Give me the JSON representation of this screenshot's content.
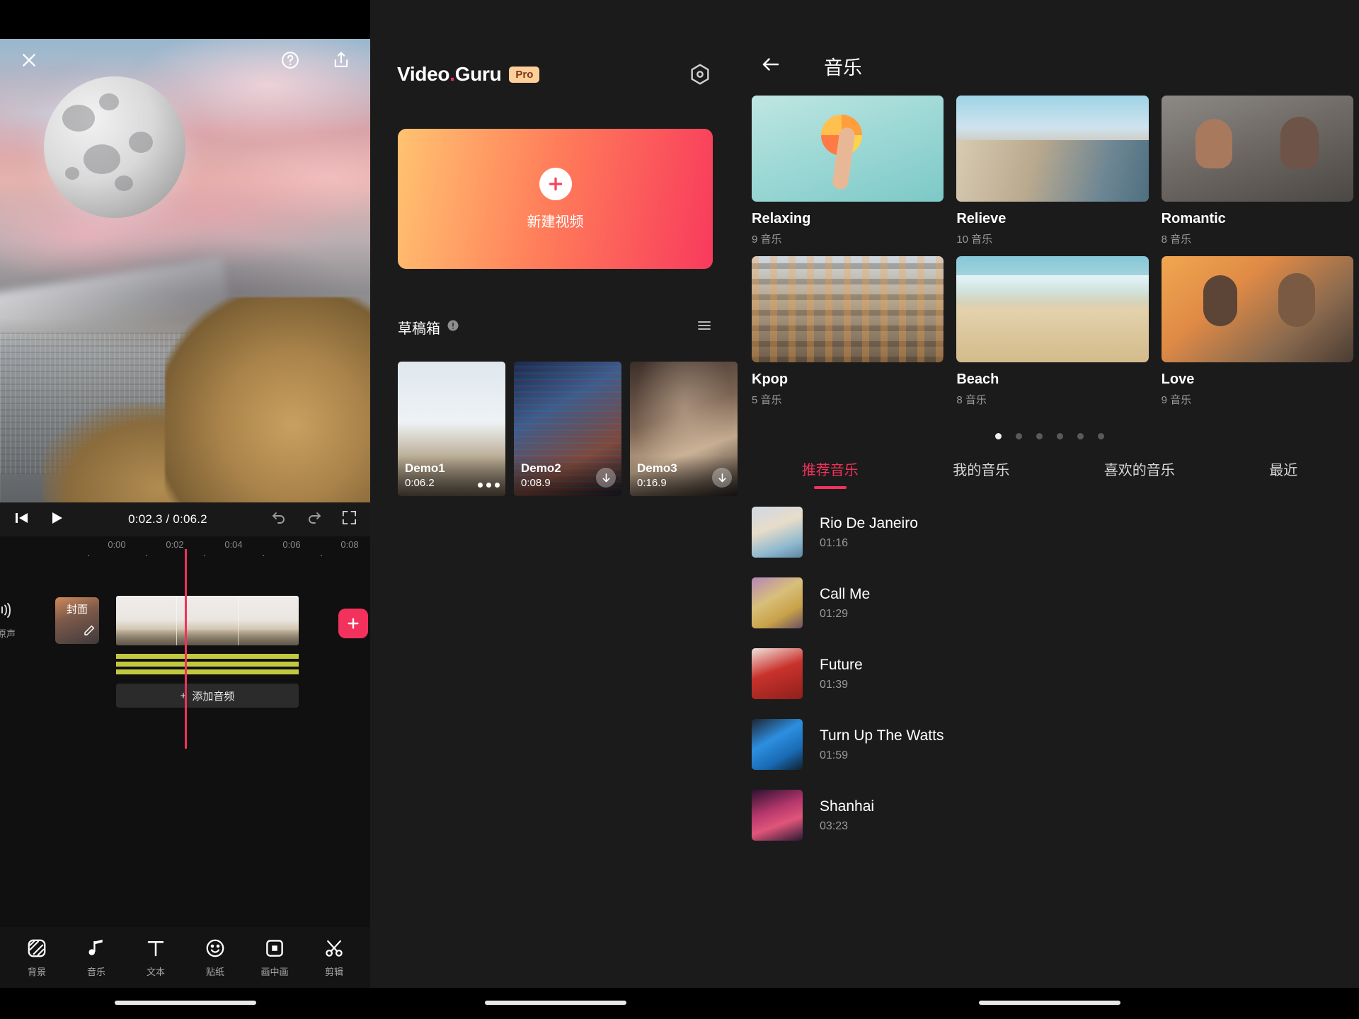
{
  "editor": {
    "close_icon": "close-icon",
    "help_icon": "help-icon",
    "share_icon": "share-icon",
    "prev_frame_icon": "previous-frame-icon",
    "play_icon": "play-icon",
    "undo_icon": "undo-icon",
    "redo_icon": "redo-icon",
    "fullscreen_icon": "fullscreen-icon",
    "current_time": "0:02.3",
    "total_time": "0:06.2",
    "time_display": "0:02.3 / 0:06.2",
    "ruler_ticks": [
      "0:00",
      "0:02",
      "0:04",
      "0:06",
      "0:08"
    ],
    "original_sound_label": "原声",
    "cover_label": "封面",
    "add_audio_label": "添加音频",
    "add_clip_label": "+",
    "tabs": [
      {
        "label": "背景",
        "icon": "background-icon"
      },
      {
        "label": "音乐",
        "icon": "music-note-icon"
      },
      {
        "label": "文本",
        "icon": "text-icon"
      },
      {
        "label": "贴纸",
        "icon": "sticker-smiley-icon"
      },
      {
        "label": "画中画",
        "icon": "picture-in-picture-icon"
      },
      {
        "label": "剪辑",
        "icon": "scissors-icon"
      }
    ]
  },
  "home": {
    "brand_name": "Video",
    "brand_dot": ".",
    "brand_name2": "Guru",
    "pro_badge": "Pro",
    "settings_icon": "settings-gear-icon",
    "new_video_label": "新建视频",
    "drafts_title": "草稿箱",
    "drafts_info_icon": "info-icon",
    "drafts_list_icon": "list-view-icon",
    "drafts": [
      {
        "name": "Demo1",
        "duration": "0:06.2",
        "action": "more-options-icon"
      },
      {
        "name": "Demo2",
        "duration": "0:08.9",
        "action": "download-icon"
      },
      {
        "name": "Demo3",
        "duration": "0:16.9",
        "action": "download-icon"
      }
    ]
  },
  "music": {
    "back_icon": "back-arrow-icon",
    "title": "音乐",
    "categories": [
      {
        "name": "Relaxing",
        "count": "9 音乐",
        "thumb": "th-relax"
      },
      {
        "name": "Relieve",
        "count": "10 音乐",
        "thumb": "th-relieve"
      },
      {
        "name": "Romantic",
        "count": "8 音乐",
        "thumb": "th-romantic"
      },
      {
        "name": "Kpop",
        "count": "5 音乐",
        "thumb": "th-kpop"
      },
      {
        "name": "Beach",
        "count": "8 音乐",
        "thumb": "th-beach"
      },
      {
        "name": "Love",
        "count": "9 音乐",
        "thumb": "th-love"
      }
    ],
    "pager": {
      "total": 6,
      "active_index": 0
    },
    "tabs": [
      {
        "label": "推荐音乐",
        "active": true
      },
      {
        "label": "我的音乐",
        "active": false
      },
      {
        "label": "喜欢的音乐",
        "active": false
      },
      {
        "label": "最近",
        "active": false
      }
    ],
    "tracks": [
      {
        "name": "Rio De Janeiro",
        "duration": "01:16",
        "cover": "cv-rio"
      },
      {
        "name": "Call Me",
        "duration": "01:29",
        "cover": "cv-call"
      },
      {
        "name": "Future",
        "duration": "01:39",
        "cover": "cv-future"
      },
      {
        "name": "Turn Up The Watts",
        "duration": "01:59",
        "cover": "cv-turn"
      },
      {
        "name": "Shanhai",
        "duration": "03:23",
        "cover": "cv-shanhai"
      }
    ]
  },
  "colors": {
    "accent_pink": "#f2315c",
    "gradient_start": "#ffc371",
    "gradient_end": "#f83a5c",
    "pro_badge_bg": "#ffcf9a",
    "audio_track": "#c3c93f"
  }
}
